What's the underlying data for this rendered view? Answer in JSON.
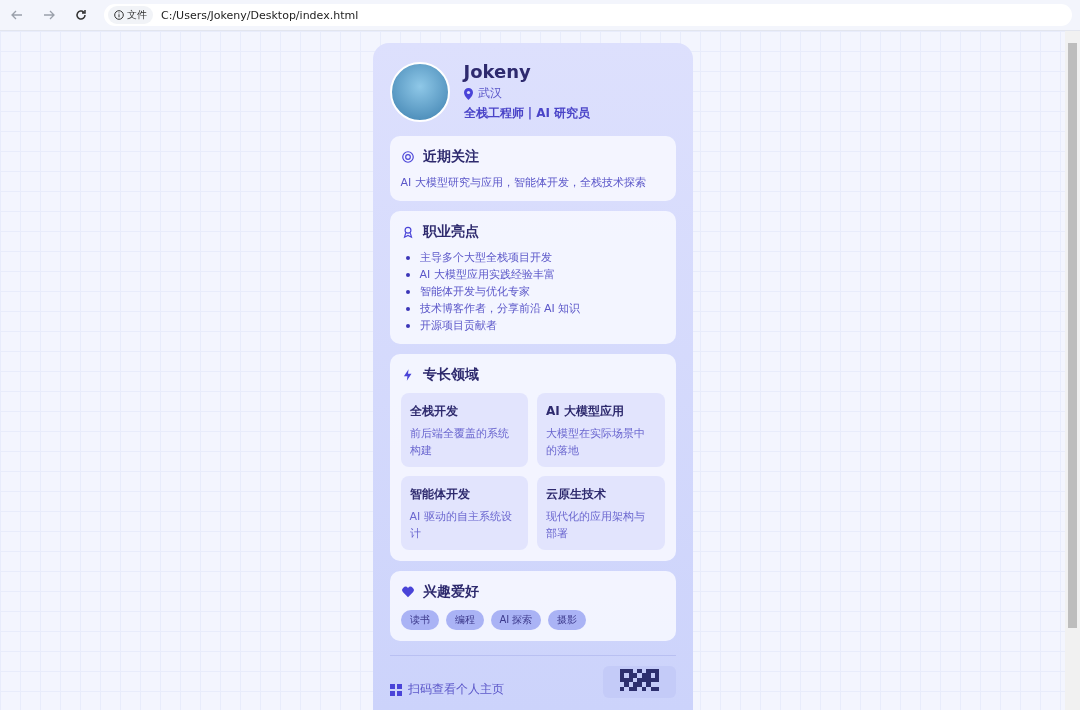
{
  "browser": {
    "security_label": "文件",
    "url": "C:/Users/Jokeny/Desktop/index.html"
  },
  "profile": {
    "name": "Jokeny",
    "location": "武汉",
    "title": "全栈工程师 | AI 研究员"
  },
  "sections": [
    {
      "kind": "text",
      "heading": "近期关注",
      "text": "AI 大模型研究与应用，智能体开发，全栈技术探索"
    },
    {
      "kind": "list",
      "heading": "职业亮点",
      "items": [
        "主导多个大型全栈项目开发",
        "AI 大模型应用实践经验丰富",
        "智能体开发与优化专家",
        "技术博客作者，分享前沿 AI 知识",
        "开源项目贡献者"
      ]
    },
    {
      "kind": "grid",
      "heading": "专长领域",
      "cards": [
        {
          "title": "全栈开发",
          "desc": "前后端全覆盖的系统构建"
        },
        {
          "title": "AI 大模型应用",
          "desc": "大模型在实际场景中的落地"
        },
        {
          "title": "智能体开发",
          "desc": "AI 驱动的自主系统设计"
        },
        {
          "title": "云原生技术",
          "desc": "现代化的应用架构与部署"
        }
      ]
    },
    {
      "kind": "tags",
      "heading": "兴趣爱好",
      "tags": [
        "读书",
        "编程",
        "AI 探索",
        "摄影"
      ]
    }
  ],
  "footer": {
    "qr_label": "扫码查看个人主页"
  }
}
